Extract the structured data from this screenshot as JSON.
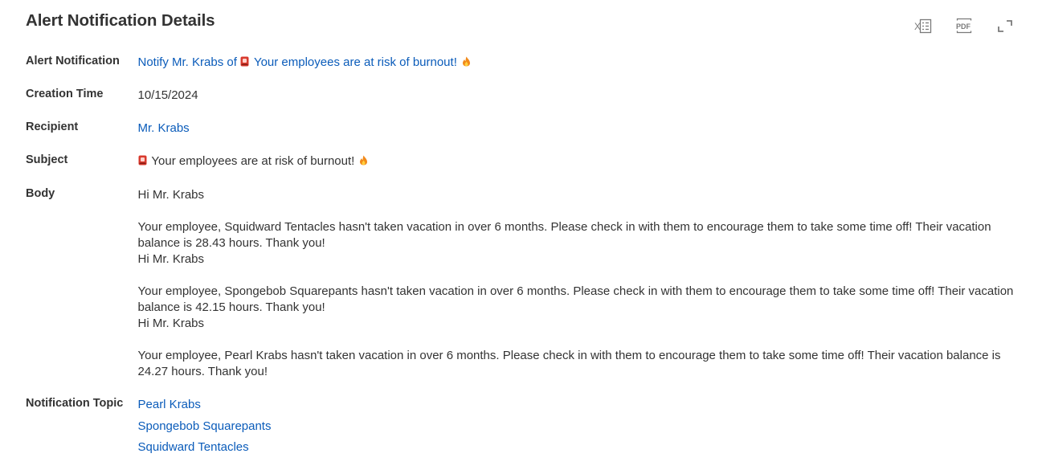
{
  "page": {
    "title": "Alert Notification Details"
  },
  "toolbar": {
    "excel_icon": "excel-export-icon",
    "pdf_icon": "pdf-export-icon",
    "expand_icon": "expand-icon"
  },
  "fields": {
    "alert_notification": {
      "label": "Alert Notification",
      "prefix": "Notify Mr. Krabs of ",
      "text": " Your employees are at risk of burnout! "
    },
    "creation_time": {
      "label": "Creation Time",
      "value": "10/15/2024"
    },
    "recipient": {
      "label": "Recipient",
      "value": "Mr. Krabs"
    },
    "subject": {
      "label": "Subject",
      "text": " Your employees are at risk of burnout! "
    },
    "body": {
      "label": "Body",
      "messages": [
        {
          "greeting": "Hi Mr. Krabs",
          "text": " Your employee, Squidward Tentacles hasn't taken vacation in over 6 months. Please check in with them to encourage them to take some time off! Their vacation balance is 28.43 hours. Thank you!"
        },
        {
          "greeting": "Hi Mr. Krabs",
          "text": " Your employee, Spongebob Squarepants hasn't taken vacation in over 6 months. Please check in with them to encourage them to take some time off! Their vacation balance is 42.15 hours. Thank you!"
        },
        {
          "greeting": "Hi Mr. Krabs",
          "text": " Your employee, Pearl Krabs hasn't taken vacation in over 6 months. Please check in with them to encourage them to take some time off! Their vacation balance is 24.27 hours. Thank you!"
        }
      ]
    },
    "notification_topic": {
      "label": "Notification Topic",
      "items": [
        "Pearl Krabs",
        "Spongebob Squarepants",
        "Squidward Tentacles"
      ]
    }
  },
  "colors": {
    "link": "#0b5cba",
    "text": "#333333",
    "icon": "#7a7a7a"
  }
}
